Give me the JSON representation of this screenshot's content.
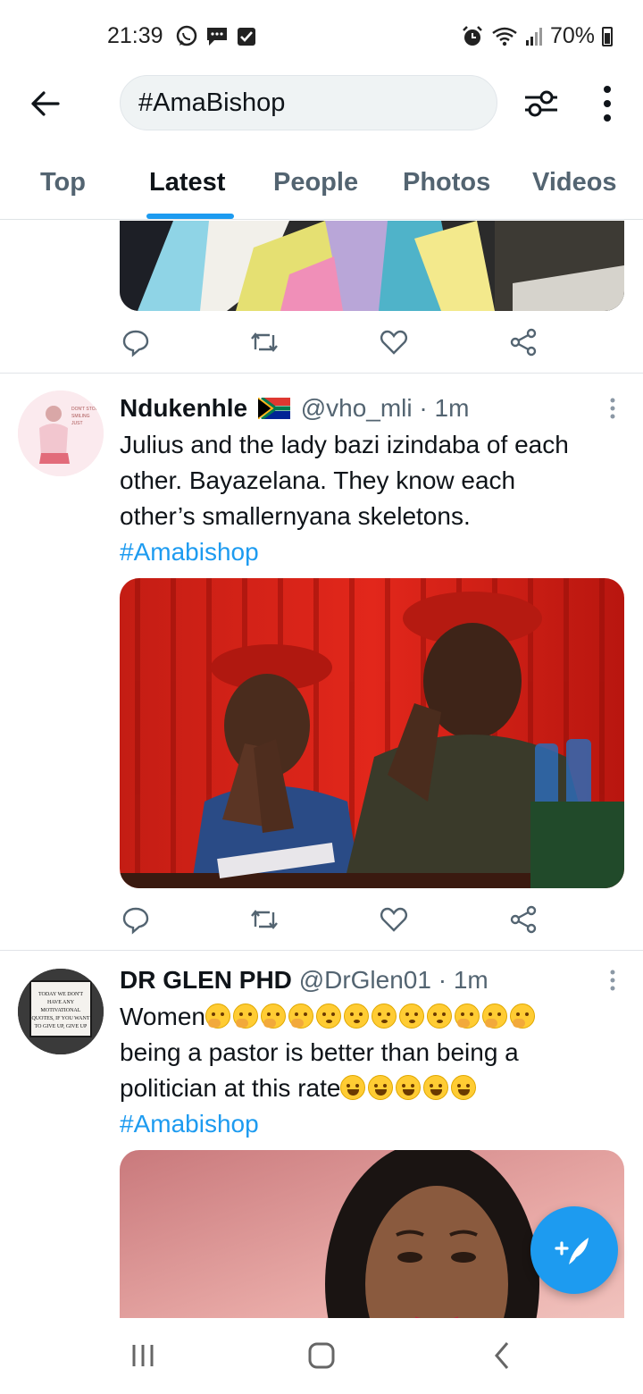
{
  "status_bar": {
    "time": "21:39",
    "battery": "70%",
    "left_icons": [
      "whatsapp-icon",
      "message-icon",
      "check-icon"
    ],
    "right_icons": [
      "alarm-icon",
      "wifi-icon",
      "signal-icon",
      "battery-icon"
    ]
  },
  "header": {
    "search_value": "#AmaBishop",
    "icons": [
      "back-arrow-icon",
      "filter-icon",
      "more-vertical-icon"
    ]
  },
  "tabs": [
    {
      "label": "Top",
      "active": false
    },
    {
      "label": "Latest",
      "active": true
    },
    {
      "label": "People",
      "active": false
    },
    {
      "label": "Photos",
      "active": false
    },
    {
      "label": "Videos",
      "active": false
    }
  ],
  "tweets": [
    {
      "name": "Ndukenhle",
      "flag": "south-africa-flag",
      "handle": "@vho_mli",
      "separator": "·",
      "time": "1m",
      "text_lines": [
        "Julius and the lady bazi izindaba of each",
        "other. Bayazelana. They know each",
        "other’s smallernyana skeletons."
      ],
      "hashtag": "#Amabishop",
      "avatar_text": "DON'T STOP SMILING JUST BECAUSE SOMEONE IS INTIMIDATED BY YOUR LIGHT"
    },
    {
      "name": "DR GLEN PHD",
      "handle": "@DrGlen01",
      "separator": "·",
      "time": "1m",
      "line1_text": "Women",
      "line1_emojis": [
        "hand-over-mouth",
        "hand-over-mouth",
        "hand-over-mouth",
        "hand-over-mouth",
        "flushed",
        "flushed",
        "flushed",
        "flushed",
        "flushed",
        "hand-over-mouth",
        "hand-over-mouth",
        "hand-over-mouth"
      ],
      "line2_text": "being a pastor is better than being a",
      "line3_text": "politician at this rate",
      "line3_emojis": [
        "rolling-laughing",
        "rolling-laughing",
        "rolling-laughing",
        "rolling-laughing",
        "rolling-laughing"
      ],
      "hashtag": "#Amabishop",
      "avatar_text": "TODAY WE DON'T HAVE ANY MOTIVATIONAL QUOTES, IF YOU WANT TO GIVE UP, GIVE UP"
    }
  ],
  "actions": [
    "reply-icon",
    "retweet-icon",
    "like-icon",
    "share-icon"
  ],
  "fab": {
    "icon": "compose-tweet-icon",
    "symbol": "+"
  },
  "nav_bar": [
    "recent-apps-icon",
    "home-icon",
    "back-icon"
  ],
  "colors": {
    "accent": "#1d9bf0",
    "text": "#0f1419",
    "secondary": "#536471"
  }
}
